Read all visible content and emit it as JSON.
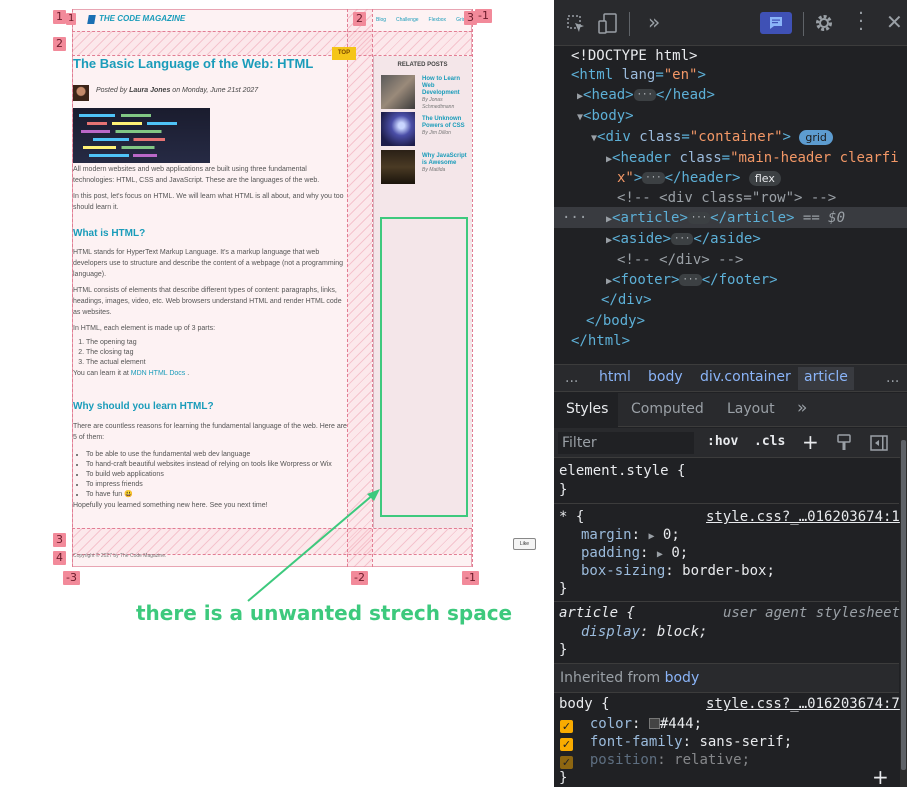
{
  "page": {
    "brand": "THE CODE MAGAZINE",
    "nav": [
      "Blog",
      "Challenge",
      "Flexbox",
      "Grid"
    ],
    "top_badge": "TOP",
    "article_title": "The Basic Language of the Web: HTML",
    "author_prefix": "Posted by",
    "author": "Laura Jones",
    "date_text": "on Monday, June 21st 2027",
    "intro_1": "All modern websites and web applications are built using three fundamental technologies: HTML, CSS and JavaScript. These are the languages of the web.",
    "intro_2": "In this post, let's focus on HTML. We will learn what HTML is all about, and why you too should learn it.",
    "h_what": "What is HTML?",
    "what_1": "HTML stands for HyperText Markup Language. It's a markup language that web developers use to structure and describe the content of a webpage (not a programming language).",
    "what_2": "HTML consists of elements that describe different types of content: paragraphs, links, headings, images, video, etc. Web browsers understand HTML and render HTML code as websites.",
    "what_3": "In HTML, each element is made up of 3 parts:",
    "parts": [
      "The opening tag",
      "The closing tag",
      "The actual element"
    ],
    "learn_prefix": "You can learn it at",
    "learn_link": "MDN HTML Docs",
    "learn_suffix": ".",
    "h_why": "Why should you learn HTML?",
    "why_1": "There are countless reasons for learning the fundamental language of the web. Here are 5 of them:",
    "reasons": [
      "To be able to use the fundamental web dev language",
      "To hand-craft beautiful websites instead of relying on tools like Worpress or Wix",
      "To build web applications",
      "To impress friends",
      "To have fun 😃"
    ],
    "closing": "Hopefully you learned something new here. See you next time!",
    "related_heading": "RELATED POSTS",
    "related": [
      {
        "title": "How to Learn Web Development",
        "author": "By Jonas Schmedtmann"
      },
      {
        "title": "The Unknown Powers of CSS",
        "author": "By Jim Dillon"
      },
      {
        "title": "Why JavaScript is Awesome",
        "author": "By Matilda"
      }
    ],
    "copyright": "Copyright © 2027 by The Code Magazine.",
    "like_button": "Like",
    "annotation": "there is a unwanted strech space",
    "grid_markers": {
      "top_left": "1",
      "top_mid": "2",
      "top_right": "3",
      "top_neg": "-1",
      "row2": "2",
      "row3": "3",
      "row4": "4",
      "bot_left": "-3",
      "bot_mid": "-2",
      "bot_right": "-1"
    }
  },
  "devtools": {
    "dom": {
      "doctype": "<!DOCTYPE html>",
      "html_open_tag": "<html",
      "html_lang_attr": "lang",
      "html_lang_val": "\"en\"",
      "html_close_bracket": ">",
      "head": "<head>",
      "head_close": "</head>",
      "body": "<body>",
      "div_open": "<div",
      "div_class_attr": "class",
      "div_class_val": "\"container\"",
      "div_bracket": ">",
      "grid_badge": "grid",
      "header_open": "<header",
      "header_class_attr": "class",
      "header_class_val_1": "\"main-header clearfi",
      "header_class_val_2": "x\"",
      "header_close": "</header>",
      "flex_badge": "flex",
      "comment_row": "<!-- <div class=\"row\"> -->",
      "article_open": "<article>",
      "article_close": "</article>",
      "article_suffix": "== $0",
      "aside_open": "<aside>",
      "aside_close": "</aside>",
      "comment_div": "<!-- </div> -->",
      "footer_open": "<footer>",
      "footer_close": "</footer>",
      "div_close": "</div>",
      "body_close": "</body>",
      "html_close": "</html>",
      "ellipsis": "···"
    },
    "breadcrumbs": [
      "html",
      "body",
      "div.container",
      "article"
    ],
    "tabs": [
      "Styles",
      "Computed",
      "Layout"
    ],
    "filter_placeholder": "Filter",
    "hov": ":hov",
    ".cls": ".cls",
    "styles": {
      "element_style": "element.style {",
      "close_brace": "}",
      "universal_selector": "* {",
      "universal_source": "style.css?_…016203674:1",
      "margin_prop": "margin",
      "margin_val": "0;",
      "padding_prop": "padding",
      "padding_val": "0;",
      "boxsizing_prop": "box-sizing",
      "boxsizing_val": "border-box;",
      "article_selector": "article {",
      "ua_label": "user agent stylesheet",
      "display_prop": "display",
      "display_val": "block;",
      "inherited_prefix": "Inherited from",
      "inherited_from": "body",
      "body_selector": "body {",
      "body_source": "style.css?_…016203674:7",
      "color_prop": "color",
      "color_val": "#444;",
      "font_prop": "font-family",
      "font_val": "sans-serif;",
      "position_prop": "position",
      "position_val": "relative;"
    }
  }
}
